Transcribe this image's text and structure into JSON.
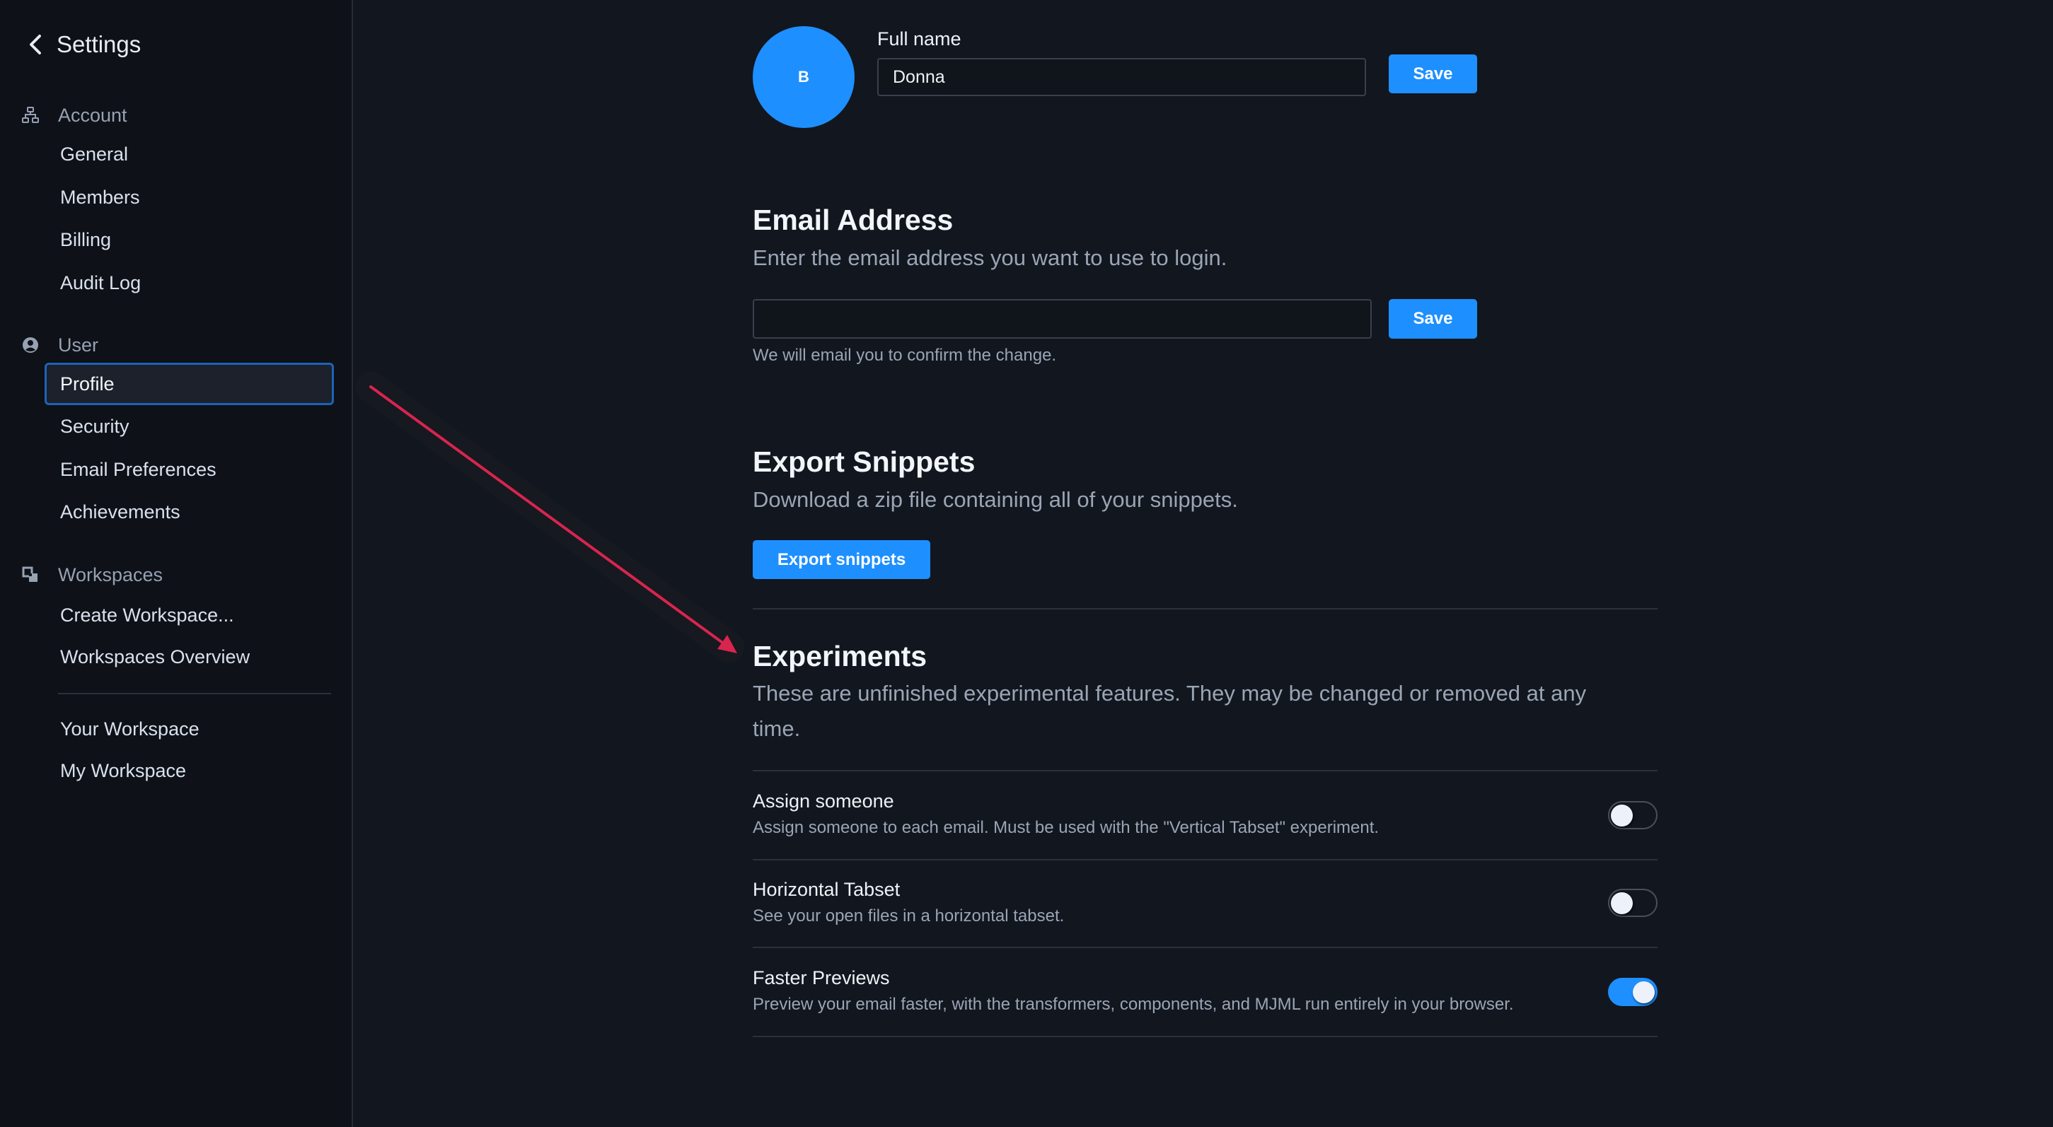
{
  "sidebar": {
    "title": "Settings",
    "groups": [
      {
        "label": "Account",
        "icon": "sitemap-icon",
        "items": [
          "General",
          "Members",
          "Billing",
          "Audit Log"
        ]
      },
      {
        "label": "User",
        "icon": "user-circle-icon",
        "items": [
          "Profile",
          "Security",
          "Email Preferences",
          "Achievements"
        ]
      },
      {
        "label": "Workspaces",
        "icon": "workspaces-icon",
        "items": [
          "Create Workspace...",
          "Workspaces Overview"
        ]
      }
    ],
    "active_item": "Profile",
    "workspaces": [
      "Your Workspace",
      "My Workspace"
    ]
  },
  "profile": {
    "avatar_initial": "B",
    "full_name_label": "Full name",
    "full_name_value": "Donna",
    "save_label": "Save"
  },
  "email": {
    "heading": "Email Address",
    "description": "Enter the email address you want to use to login.",
    "value": "",
    "save_label": "Save",
    "help": "We will email you to confirm the change."
  },
  "export": {
    "heading": "Export Snippets",
    "description": "Download a zip file containing all of your snippets.",
    "button_label": "Export snippets"
  },
  "experiments": {
    "heading": "Experiments",
    "description_line1": "These are unfinished experimental features. They may be changed or removed at any",
    "description_line2": "time.",
    "items": [
      {
        "title": "Assign someone",
        "description": "Assign someone to each email. Must be used with the \"Vertical Tabset\" experiment.",
        "enabled": false
      },
      {
        "title": "Horizontal Tabset",
        "description": "See your open files in a horizontal tabset.",
        "enabled": false
      },
      {
        "title": "Faster Previews",
        "description": "Preview your email faster, with the transformers, components, and MJML run entirely in your browser.",
        "enabled": true
      }
    ]
  },
  "colors": {
    "accent": "#1e8fff",
    "annotation_arrow": "#d9244f",
    "background": "#12161e",
    "sidebar_background": "#0e1118"
  }
}
